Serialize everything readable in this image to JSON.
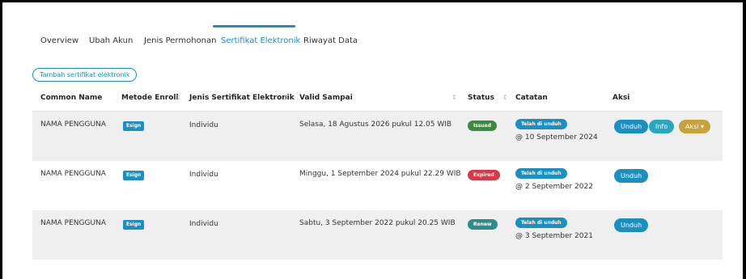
{
  "tabs": [
    {
      "label": "Overview",
      "active": false
    },
    {
      "label": "Ubah Akun",
      "active": false
    },
    {
      "label": "Jenis Permohonan",
      "active": false
    },
    {
      "label": "Sertifikat Elektronik",
      "active": true
    },
    {
      "label": "Riwayat Data",
      "active": false
    }
  ],
  "add_button_label": "Tambah sertifikat elektronik",
  "table": {
    "headers": [
      "Common Name",
      "Metode Enroll",
      "Jenis Sertifikat Elektronik",
      "Valid Sampai",
      "Status",
      "Catatan",
      "Aksi"
    ],
    "sort_icon": "sort-icon",
    "rows": [
      {
        "common_name": "NAMA PENGGUNA",
        "method": "Esign",
        "type": "Individu",
        "valid_until": "Selasa, 18 Agustus 2026 pukul 12.05 WIB",
        "status": "Issued",
        "note_badge": "Telah di unduh",
        "note_date": "@ 10 September 2024",
        "actions": [
          "Unduh",
          "Info",
          "Aksi ▾"
        ]
      },
      {
        "common_name": "NAMA PENGGUNA",
        "method": "Esign",
        "type": "Individu",
        "valid_until": "Minggu, 1 September 2024 pukul 22.29 WIB",
        "status": "Expired",
        "note_badge": "Telah di unduh",
        "note_date": "@ 2 September 2022",
        "actions": [
          "Unduh"
        ]
      },
      {
        "common_name": "NAMA PENGGUNA",
        "method": "Esign",
        "type": "Individu",
        "valid_until": "Sabtu, 3 September 2022 pukul 20.25 WIB",
        "status": "Renew",
        "note_badge": "Telah di unduh",
        "note_date": "@ 3 September 2021",
        "actions": [
          "Unduh"
        ]
      }
    ]
  },
  "colors": {
    "accent": "#1a8fc0",
    "issued": "#3a8a3f",
    "expired": "#d13a47",
    "renew": "#2f8c8c",
    "info": "#2aa6c0",
    "aksi": "#c7a13a",
    "row_shade": "#efefef"
  }
}
